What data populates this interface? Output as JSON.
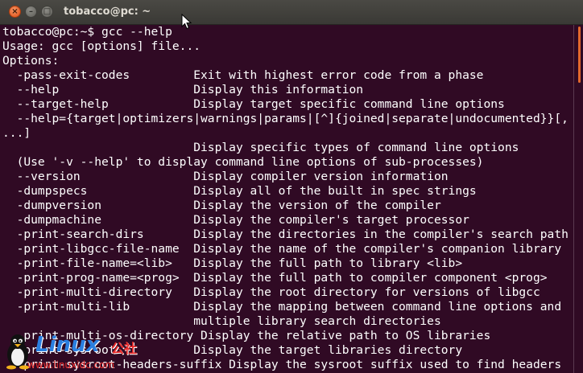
{
  "window": {
    "title": "tobacco@pc: ~",
    "close_glyph": "×",
    "minimize_glyph": "–",
    "maximize_glyph": "□"
  },
  "terminal": {
    "lines": [
      "tobacco@pc:~$ gcc --help",
      "Usage: gcc [options] file...",
      "Options:",
      "  -pass-exit-codes         Exit with highest error code from a phase",
      "  --help                   Display this information",
      "  --target-help            Display target specific command line options",
      "  --help={target|optimizers|warnings|params|[^]{joined|separate|undocumented}}[,",
      "...]",
      "                           Display specific types of command line options",
      "  (Use '-v --help' to display command line options of sub-processes)",
      "  --version                Display compiler version information",
      "  -dumpspecs               Display all of the built in spec strings",
      "  -dumpversion             Display the version of the compiler",
      "  -dumpmachine             Display the compiler's target processor",
      "  -print-search-dirs       Display the directories in the compiler's search path",
      "  -print-libgcc-file-name  Display the name of the compiler's companion library",
      "  -print-file-name=<lib>   Display the full path to library <lib>",
      "  -print-prog-name=<prog>  Display the full path to compiler component <prog>",
      "  -print-multi-directory   Display the root directory for versions of libgcc",
      "  -print-multi-lib         Display the mapping between command line options and",
      "                           multiple library search directories",
      "  -print-multi-os-directory Display the relative path to OS libraries",
      "  -print-sysroot           Display the target libraries directory",
      "  -print-sysroot-headers-suffix Display the sysroot suffix used to find headers"
    ]
  },
  "watermark": {
    "brand": "Linux",
    "brand_suffix": "公社",
    "url": "www.linuxidc.com"
  },
  "colors": {
    "terminal_background": "#300a24",
    "terminal_text": "#ffffff",
    "titlebar": "#3c3b37",
    "scroll_thumb": "#e2682c"
  }
}
